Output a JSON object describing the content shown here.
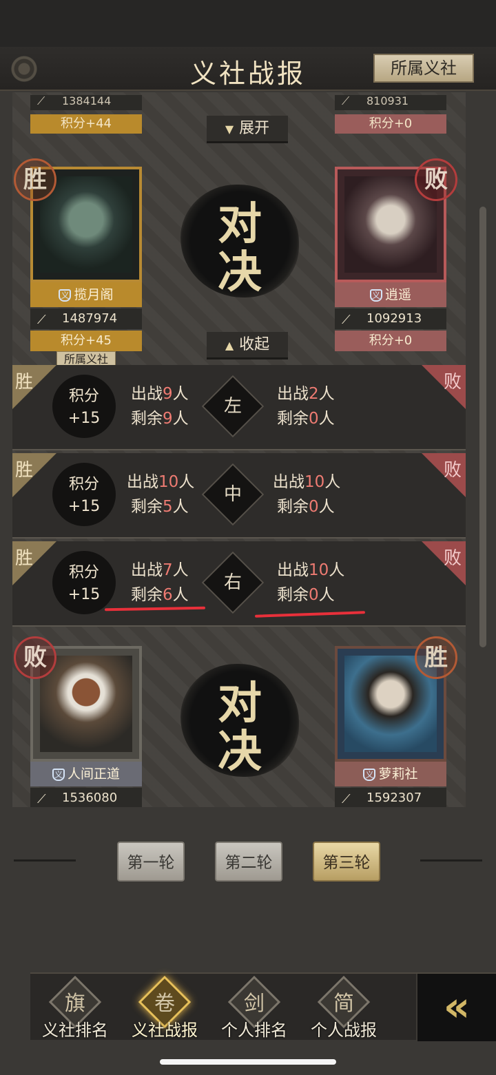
{
  "header": {
    "title": "义社战报",
    "guild_button": "所属义社"
  },
  "top_partial": {
    "left_power": "1384144",
    "left_score": "积分+44",
    "right_power": "810931",
    "right_score": "积分+0",
    "expand_label": "展开"
  },
  "match1": {
    "vs_top": "对",
    "vs_bottom": "决",
    "left": {
      "result": "胜",
      "name": "揽月阁",
      "power": "1487974",
      "score": "积分+45",
      "tag": "所属义社"
    },
    "right": {
      "result": "败",
      "name": "逍遥",
      "power": "1092913",
      "score": "积分+0"
    },
    "collapse_label": "收起",
    "rows": [
      {
        "win": "胜",
        "lose": "败",
        "score_label": "积分",
        "score_value": "+15",
        "lane": "左",
        "left_deploy_pre": "出战",
        "left_deploy_num": "9",
        "left_remain_pre": "剩余",
        "left_remain_num": "9",
        "right_deploy_pre": "出战",
        "right_deploy_num": "2",
        "right_remain_pre": "剩余",
        "right_remain_num": "0",
        "unit": "人"
      },
      {
        "win": "胜",
        "lose": "败",
        "score_label": "积分",
        "score_value": "+15",
        "lane": "中",
        "left_deploy_pre": "出战",
        "left_deploy_num": "10",
        "left_remain_pre": "剩余",
        "left_remain_num": "5",
        "right_deploy_pre": "出战",
        "right_deploy_num": "10",
        "right_remain_pre": "剩余",
        "right_remain_num": "0",
        "unit": "人"
      },
      {
        "win": "胜",
        "lose": "败",
        "score_label": "积分",
        "score_value": "+15",
        "lane": "右",
        "left_deploy_pre": "出战",
        "left_deploy_num": "7",
        "left_remain_pre": "剩余",
        "left_remain_num": "6",
        "right_deploy_pre": "出战",
        "right_deploy_num": "10",
        "right_remain_pre": "剩余",
        "right_remain_num": "0",
        "unit": "人"
      }
    ]
  },
  "match2": {
    "vs_top": "对",
    "vs_bottom": "决",
    "left": {
      "result": "败",
      "name": "人间正道",
      "power": "1536080"
    },
    "right": {
      "result": "胜",
      "name": "萝莉社",
      "power": "1592307"
    }
  },
  "rounds": [
    {
      "label": "第一轮",
      "active": false
    },
    {
      "label": "第二轮",
      "active": false
    },
    {
      "label": "第三轮",
      "active": true
    }
  ],
  "nav": [
    {
      "label": "义社排名",
      "glyph": "旗"
    },
    {
      "label": "义社战报",
      "glyph": "卷"
    },
    {
      "label": "个人排名",
      "glyph": "剑"
    },
    {
      "label": "个人战报",
      "glyph": "简"
    }
  ],
  "colors": {
    "accent_gold": "#b98a2c",
    "lose_red": "#9c4b4b",
    "number_red": "#ee7b72"
  }
}
